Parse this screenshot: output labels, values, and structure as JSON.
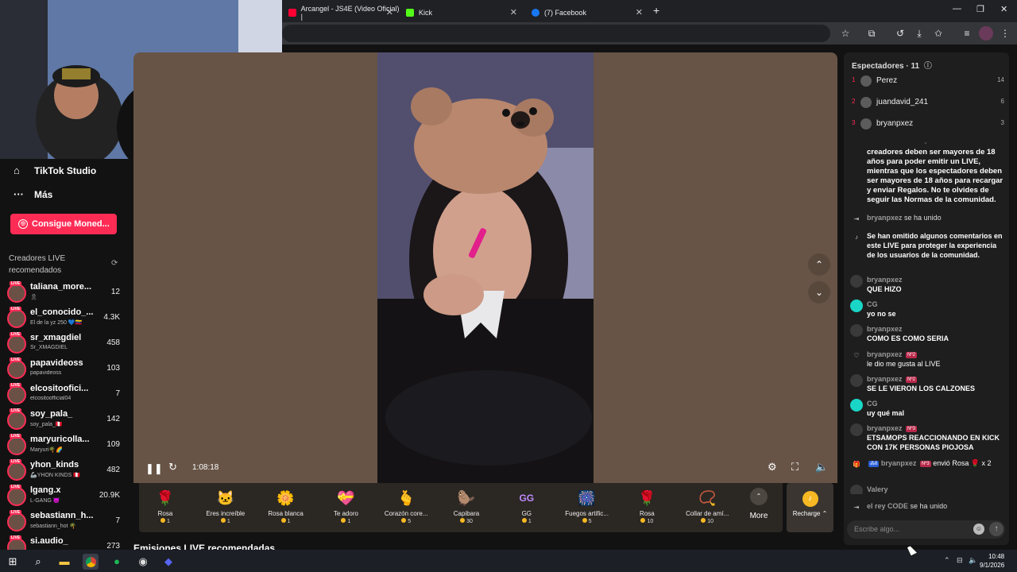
{
  "browser": {
    "tabs": [
      {
        "title": "Arcangel - JS4E (Video Oficial) |",
        "favicon_color": "#ff0033"
      },
      {
        "title": "Kick",
        "favicon_color": "#53fc18"
      },
      {
        "title": "(7) Facebook",
        "favicon_color": "#1877f2"
      }
    ],
    "new_tab": "+"
  },
  "sidebar": {
    "nav": [
      {
        "label": "TikTok Studio",
        "icon": "home-icon"
      },
      {
        "label": "Más",
        "icon": "more-dots-icon"
      }
    ],
    "coins_button": "Consigue Moned...",
    "creators_header": "Creadores LIVE recomendados",
    "creators": [
      {
        "name": "taliana_more...",
        "sub": "🎗",
        "count": "12"
      },
      {
        "name": "el_conocido_...",
        "sub": "El de la yz 250 💙🇻🇪",
        "count": "4.3K"
      },
      {
        "name": "sr_xmagdiel",
        "sub": "Sr_XMAGDIEL",
        "count": "458"
      },
      {
        "name": "papavideoss",
        "sub": "papavideoss",
        "count": "103"
      },
      {
        "name": "elcositoofici...",
        "sub": "elcositoofficial04",
        "count": "7"
      },
      {
        "name": "soy_pala_",
        "sub": "soy_pala_🇵🇪",
        "count": "142"
      },
      {
        "name": "maryuricolla...",
        "sub": "Maryuri🌴🌈",
        "count": "109"
      },
      {
        "name": "yhon_kinds",
        "sub": "🦾YHON KINDS 🇵🇪",
        "count": "482"
      },
      {
        "name": "lgang.x",
        "sub": "L-GANG 😈",
        "count": "20.9K"
      },
      {
        "name": "sebastiann_h...",
        "sub": "sebastiann_hot 🌴",
        "count": "7"
      },
      {
        "name": "si.audio_",
        "sub": "",
        "count": "273"
      }
    ]
  },
  "player": {
    "timecode": "1:08:18",
    "recommended_heading": "Emisiones LIVE recomendadas"
  },
  "gifts": [
    {
      "name": "Rosa",
      "price": "1",
      "icon": "🌹"
    },
    {
      "name": "Eres increíble",
      "price": "1",
      "icon": "🐱"
    },
    {
      "name": "Rosa blanca",
      "price": "1",
      "icon": "🌼"
    },
    {
      "name": "Te adoro",
      "price": "1",
      "icon": "💝"
    },
    {
      "name": "Corazón core...",
      "price": "5",
      "icon": "🫰"
    },
    {
      "name": "Capibara",
      "price": "30",
      "icon": "🦫"
    },
    {
      "name": "GG",
      "price": "1",
      "icon": "GG"
    },
    {
      "name": "Fuegos artific...",
      "price": "5",
      "icon": "🎆"
    },
    {
      "name": "Rosa",
      "price": "10",
      "icon": "🌹"
    },
    {
      "name": "Collar de amí...",
      "price": "10",
      "icon": "📿"
    }
  ],
  "gifts_more": "More",
  "recharge": "Recharge",
  "chat": {
    "viewers_title": "Espectadores · 11",
    "top_viewers": [
      {
        "rank": "1",
        "name": "Perez",
        "score": "14"
      },
      {
        "rank": "2",
        "name": "juandavid_241",
        "score": "6"
      },
      {
        "rank": "3",
        "name": "bryanpxez",
        "score": "3"
      }
    ],
    "system_notice": "creadores deben ser mayores de 18 años para poder emitir un LIVE, mientras que los espectadores deben ser mayores de 18 años para recargar y enviar Regalos. No te olvides de seguir las Normas de la comunidad.",
    "joined_1_user": "bryanpxez",
    "joined_1_text": "se ha unido",
    "omitted_notice": "Se han omitido algunos comentarios en este LIVE para proteger la experiencia de los usuarios de la comunidad.",
    "messages": [
      {
        "user": "bryanpxez",
        "badge": "",
        "text": "QUE HIZO"
      },
      {
        "user": "CG",
        "badge": "",
        "text": "yo no se"
      },
      {
        "user": "bryanpxez",
        "badge": "",
        "text": "COMO ES COMO SERIA"
      },
      {
        "user": "bryanpxez",
        "badge": "Nº2",
        "text": "le dio me gusta al LIVE"
      },
      {
        "user": "bryanpxez",
        "badge": "Nº2",
        "text": "SE LE VIERON LOS CALZONES"
      },
      {
        "user": "CG",
        "badge": "",
        "text": "uy qué mal"
      },
      {
        "user": "bryanpxez",
        "badge": "Nº3",
        "text": "ETSAMOPS REACCIONANDO EN KICK CON 17K PERSONAS PIOJOSA"
      }
    ],
    "gift_msg": {
      "level": "6",
      "user": "bryanpxez",
      "badge": "Nº3",
      "text": "envió Rosa 🌹 x 2"
    },
    "valery_user": "Valery",
    "joined_2_user": "el rey CODE",
    "joined_2_text": "se ha unido",
    "input_placeholder": "Escribe algo..."
  },
  "taskbar": {
    "time": "10:48",
    "date": "9/1/2026"
  }
}
